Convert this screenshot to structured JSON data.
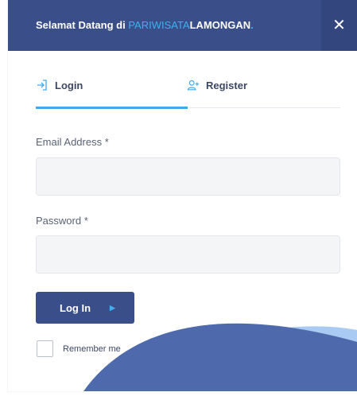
{
  "header": {
    "title_prefix": "Selamat Datang di ",
    "brand_part1": "PARIWISATA",
    "brand_part2": "LAMONGAN",
    "brand_dot": ".",
    "close_glyph": "✕"
  },
  "tabs": [
    {
      "label": "Login",
      "icon": "login-icon",
      "active": true
    },
    {
      "label": "Register",
      "icon": "user-plus-icon",
      "active": false
    }
  ],
  "form": {
    "email_label": "Email Address *",
    "email_value": "",
    "password_label": "Password *",
    "password_value": "",
    "submit_label": "Log In",
    "submit_arrow": "▶",
    "remember_label": "Remember me",
    "remember_checked": false
  },
  "colors": {
    "header_bg": "#3a4e8a",
    "accent": "#3fa9f0",
    "decor_dark": "#4e6aad",
    "decor_light": "#a9cbf3"
  }
}
